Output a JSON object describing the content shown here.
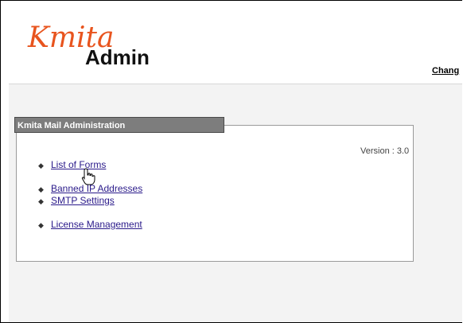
{
  "header": {
    "logo_text_script": "Kmita",
    "logo_text_bold": "Admin",
    "change_link": "Chang"
  },
  "panel": {
    "title": "Kmita Mail Administration",
    "version": "Version : 3.0",
    "menu": [
      {
        "label": "List of Forms"
      },
      {
        "label": "Banned IP Addresses"
      },
      {
        "label": "SMTP Settings"
      },
      {
        "label": "License Management"
      }
    ]
  },
  "colors": {
    "logo_orange": "#e8541e",
    "link": "#2a1a8a",
    "title_bar": "#7d7d7d"
  },
  "icons": {
    "bullet": "diamond-bullet-icon",
    "cursor": "hand-pointer-icon"
  }
}
